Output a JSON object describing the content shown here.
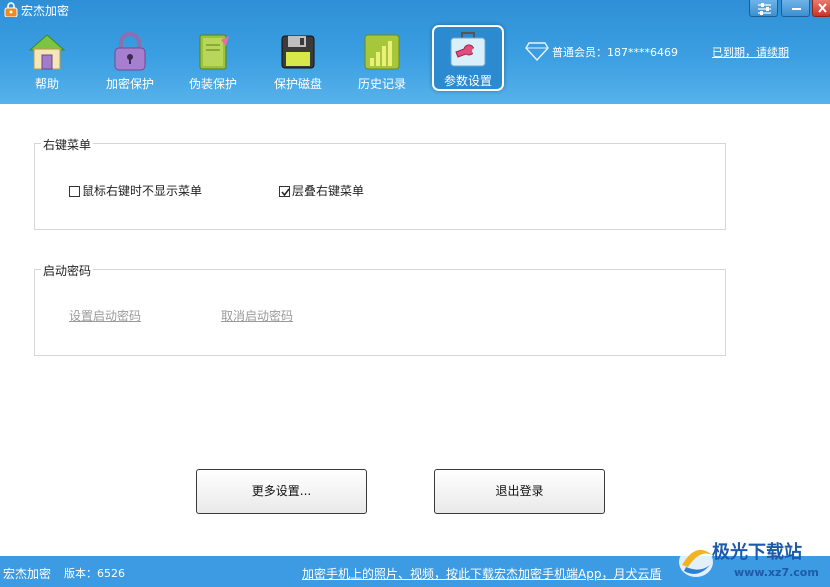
{
  "window": {
    "title": "宏杰加密"
  },
  "nav": {
    "items": [
      {
        "label": "帮助",
        "icon": "home-icon"
      },
      {
        "label": "加密保护",
        "icon": "lock-icon"
      },
      {
        "label": "伪装保护",
        "icon": "notebook-icon"
      },
      {
        "label": "保护磁盘",
        "icon": "floppy-disk-icon"
      },
      {
        "label": "历史记录",
        "icon": "history-icon"
      },
      {
        "label": "参数设置",
        "icon": "toolbox-icon",
        "active": true
      }
    ]
  },
  "account": {
    "member_text": "普通会员：187****6469",
    "renew_link": "已到期，请续期"
  },
  "context_menu_group": {
    "title": "右键菜单",
    "option_hide": {
      "label": "鼠标右键时不显示菜单",
      "checked": false
    },
    "option_cascade": {
      "label": "层叠右键菜单",
      "checked": true
    }
  },
  "startup_password_group": {
    "title": "启动密码",
    "set_link": "设置启动密码",
    "cancel_link": "取消启动密码"
  },
  "buttons": {
    "more_settings": "更多设置...",
    "logout": "退出登录"
  },
  "statusbar": {
    "app_name": "宏杰加密",
    "version": "版本：6526",
    "promo": "加密手机上的照片、视频，按此下载宏杰加密手机端App，月犬云盾"
  },
  "watermark": {
    "text": "极光下载站",
    "url": "www.xz7.com"
  },
  "colors": {
    "header": "#3b9fe2",
    "statusbar": "#3c9be2",
    "close": "#c4372a"
  }
}
